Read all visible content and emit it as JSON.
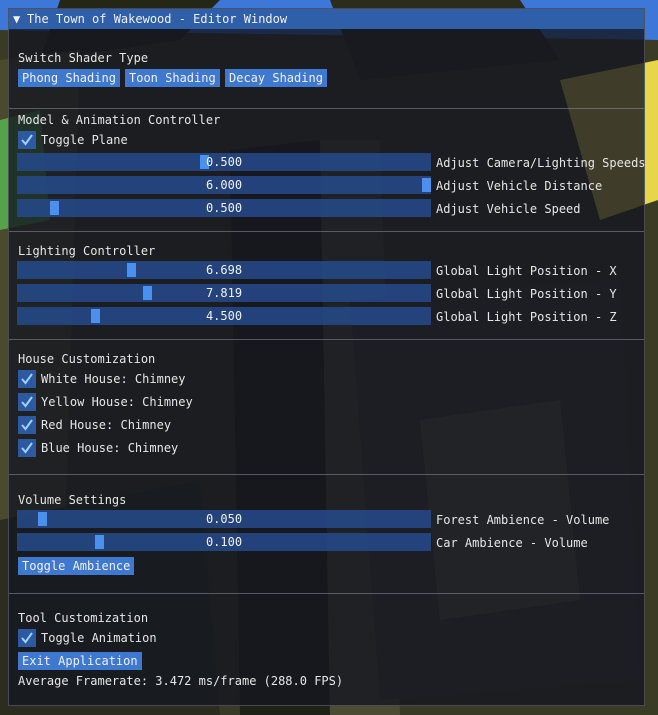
{
  "window": {
    "title": "The Town of Wakewood - Editor Window",
    "accent": "#2f5fa8"
  },
  "shader": {
    "heading": "Switch Shader Type",
    "buttons": [
      "Phong Shading",
      "Toon Shading",
      "Decay Shading"
    ]
  },
  "model": {
    "heading": "Model & Animation Controller",
    "toggle_plane": {
      "label": "Toggle Plane",
      "checked": true
    },
    "sliders": [
      {
        "value_text": "0.500",
        "label": "Adjust Camera/Lighting Speeds",
        "fraction": 0.45
      },
      {
        "value_text": "6.000",
        "label": "Adjust Vehicle Distance",
        "fraction": 1.0
      },
      {
        "value_text": "0.500",
        "label": "Adjust Vehicle Speed",
        "fraction": 0.08
      }
    ]
  },
  "lighting": {
    "heading": "Lighting Controller",
    "sliders": [
      {
        "value_text": "6.698",
        "label": "Global Light Position - X",
        "fraction": 0.27
      },
      {
        "value_text": "7.819",
        "label": "Global Light Position - Y",
        "fraction": 0.31
      },
      {
        "value_text": "4.500",
        "label": "Global Light Position - Z",
        "fraction": 0.18
      }
    ]
  },
  "house": {
    "heading": "House Customization",
    "items": [
      {
        "label": "White House: Chimney",
        "checked": true
      },
      {
        "label": "Yellow House: Chimney",
        "checked": true
      },
      {
        "label": "Red House: Chimney",
        "checked": true
      },
      {
        "label": "Blue House: Chimney",
        "checked": true
      }
    ]
  },
  "volume": {
    "heading": "Volume Settings",
    "sliders": [
      {
        "value_text": "0.050",
        "label": "Forest Ambience - Volume",
        "fraction": 0.05
      },
      {
        "value_text": "0.100",
        "label": "Car Ambience - Volume",
        "fraction": 0.19
      }
    ],
    "toggle_button": "Toggle Ambience"
  },
  "tool": {
    "heading": "Tool Customization",
    "toggle_animation": {
      "label": "Toggle Animation",
      "checked": true
    },
    "exit_button": "Exit Application",
    "framerate": "Average Framerate: 3.472 ms/frame (288.0 FPS)"
  }
}
